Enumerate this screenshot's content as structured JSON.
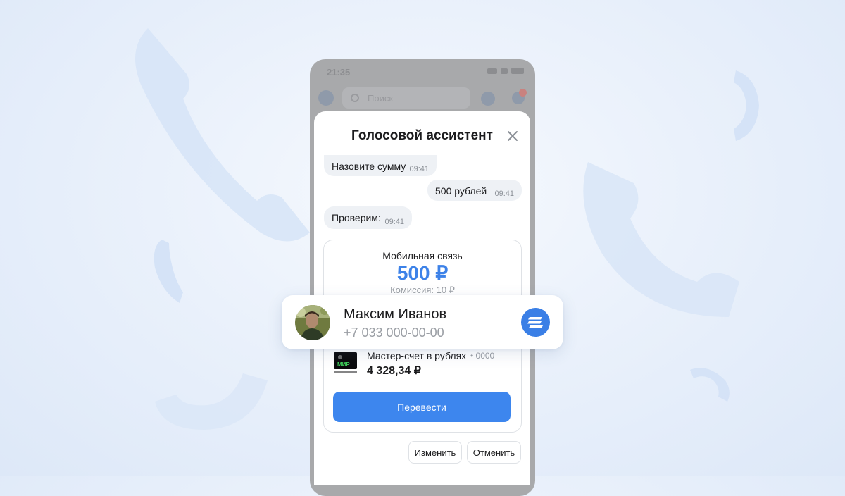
{
  "status_bar": {
    "time": "21:35"
  },
  "topbar": {
    "search_placeholder": "Поиск"
  },
  "sheet": {
    "title": "Голосовой ассистент",
    "messages": [
      {
        "text": "Назовите сумму",
        "time": "09:41",
        "from": "assistant"
      },
      {
        "text": "500  рублей",
        "time": "09:41",
        "from": "user"
      },
      {
        "text": "Проверим:",
        "time": "09:41",
        "from": "assistant"
      }
    ],
    "payment": {
      "category": "Мобильная связь",
      "amount": "500 ₽",
      "commission": "Комиссия: 10 ₽"
    },
    "account": {
      "name": "Мастер-счет в рублях",
      "mask": "• 0000",
      "balance": "4 328,34 ₽",
      "card_logo_text": "МИР"
    },
    "transfer_label": "Перевести",
    "edit_label": "Изменить",
    "cancel_label": "Отменить"
  },
  "contact": {
    "name": "Максим Иванов",
    "phone": "+7 033 000-00-00"
  },
  "colors": {
    "accent": "#3d86ee",
    "amount": "#3d82e8",
    "background": "#e6eefa"
  }
}
